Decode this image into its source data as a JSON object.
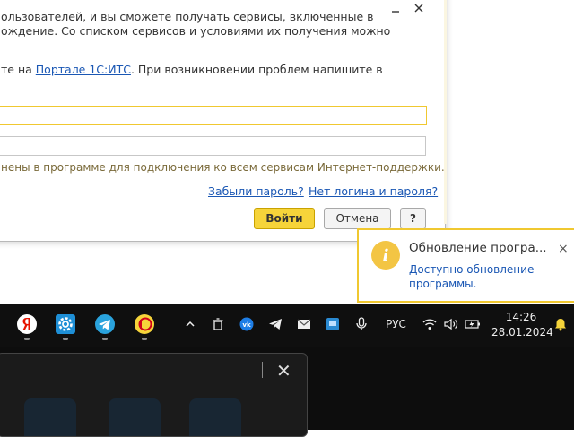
{
  "dialog": {
    "line1": "ользователей, и вы сможете получать сервисы, включенные в",
    "line2": "ождение. Со списком сервисов и условиями их получения можно",
    "line3_prefix": "те на ",
    "line3_link": "Портале 1С:ИТС",
    "line3_suffix": ". При возникновении проблем напишите в",
    "login_value": "",
    "password_value": "",
    "note": "нены в программе для подключения ко всем сервисам Интернет-поддержки.",
    "forgot_password": "Забыли пароль?",
    "no_login": "Нет логина и пароля?",
    "login_button": "Войти",
    "cancel_button": "Отмена",
    "help_button": "?"
  },
  "notification": {
    "title": "Обновление програ...",
    "text": "Доступно обновление программы.",
    "close": "×"
  },
  "taskbar": {
    "apps": [
      "yandex-browser",
      "settings",
      "telegram",
      "1c-enterprise"
    ],
    "tray": [
      "show-hidden-icons",
      "trash",
      "vk",
      "telegram",
      "mail",
      "app",
      "microphone"
    ],
    "language": "РУС",
    "time": "14:26",
    "date": "28.01.2024"
  },
  "colors": {
    "accent_yellow": "#f6d43a",
    "link_blue": "#1a57b4",
    "taskbar": "#0f0f0f"
  }
}
